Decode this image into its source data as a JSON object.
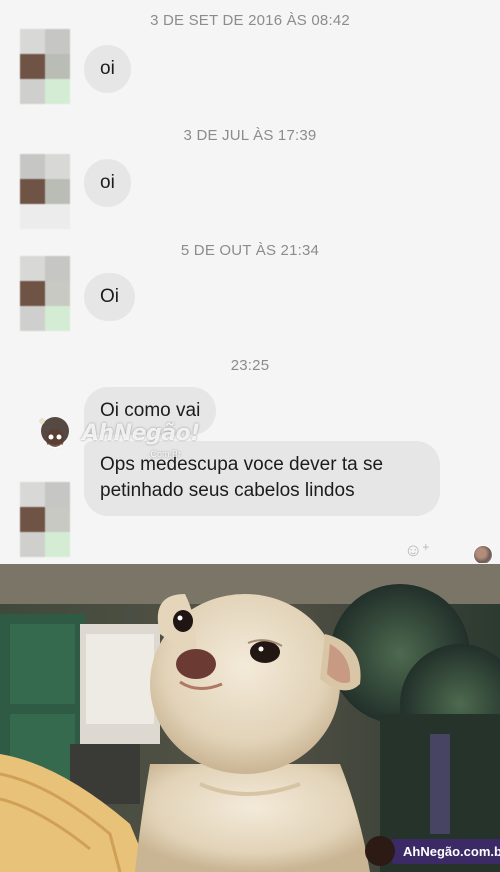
{
  "conversation": {
    "timestamps": [
      "3 DE SET DE 2016 ÀS 08:42",
      "3 DE JUL ÀS 17:39",
      "5 DE OUT ÀS 21:34",
      "23:25"
    ],
    "messages": [
      "oi",
      "oi",
      "Oi",
      "Oi como vai",
      "Ops medescupa voce dever ta se petinhado seus cabelos lindos"
    ],
    "reaction_icon": "add-reaction-icon"
  },
  "watermark": {
    "top_text": "AhNegão!",
    "top_small": ".Com.Br",
    "bottom_text": "AhNegão.com.br"
  },
  "colors": {
    "chat_background": "#f5f5f5",
    "bubble": "#e6e6e6",
    "watermark_badge": "#3b2a66"
  }
}
